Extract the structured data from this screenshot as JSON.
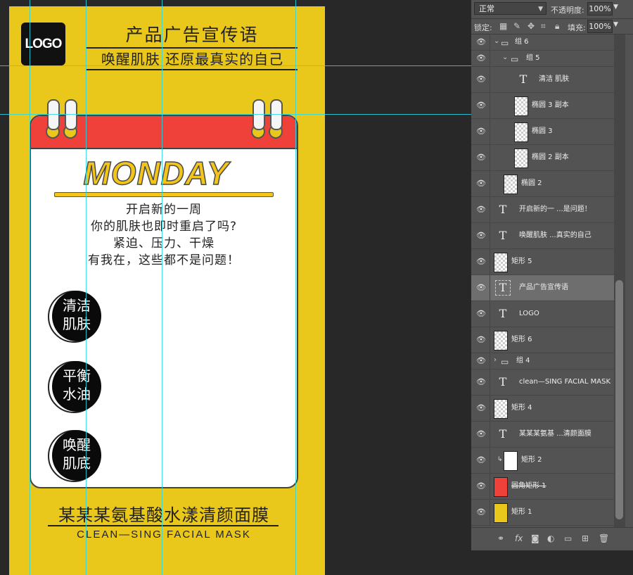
{
  "poster": {
    "logo": "LOGO",
    "headline": "产品广告宣传语",
    "subline": "唤醒肌肤 还原最真实的自己",
    "day": "MONDAY",
    "body_lines": [
      "开启新的一周",
      "你的肌肤也即时重启了吗?",
      "紧迫、压力、干燥",
      "有我在，这些都不是问题！"
    ],
    "badges": [
      {
        "line1": "清洁",
        "line2": "肌肤"
      },
      {
        "line1": "平衡",
        "line2": "水油"
      },
      {
        "line1": "唤醒",
        "line2": "肌底"
      }
    ],
    "product_cn": "某某某氨基酸水漾清颜面膜",
    "product_en": "CLEAN—SING FACIAL MASK"
  },
  "panel": {
    "blend_mode": "正常",
    "opacity_label": "不透明度:",
    "opacity_value": "100%",
    "lock_label": "锁定:",
    "fill_label": "填充:",
    "fill_value": "100%",
    "layers": [
      {
        "name": "组 6",
        "kind": "group"
      },
      {
        "name": "组 5",
        "kind": "group"
      },
      {
        "name": "清洁 肌肤",
        "kind": "text"
      },
      {
        "name": "椭圆 3 副本",
        "kind": "shape"
      },
      {
        "name": "椭圆 3",
        "kind": "shape"
      },
      {
        "name": "椭圆 2 副本",
        "kind": "shape"
      },
      {
        "name": "椭圆 2",
        "kind": "shape"
      },
      {
        "name": "开启新的一 ...是问题！",
        "kind": "text"
      },
      {
        "name": "唤醒肌肤 ...真实的自己",
        "kind": "text"
      },
      {
        "name": "矩形 5",
        "kind": "shape"
      },
      {
        "name": "产品广告宣传语",
        "kind": "text",
        "selected": true
      },
      {
        "name": "LOGO",
        "kind": "text"
      },
      {
        "name": "矩形 6",
        "kind": "shape"
      },
      {
        "name": "组 4",
        "kind": "group"
      },
      {
        "name": "clean—SING FACIAL MASK",
        "kind": "text"
      },
      {
        "name": "矩形 4",
        "kind": "shape"
      },
      {
        "name": "某某某氨基 ...清颜面膜",
        "kind": "text"
      },
      {
        "name": "矩形 2",
        "kind": "shape"
      },
      {
        "name": "圆角矩形 1",
        "kind": "shape"
      },
      {
        "name": "矩形 1",
        "kind": "shape"
      }
    ],
    "footer_fx": "fx"
  },
  "colors": {
    "poster_bg": "#eac71b",
    "calendar_header": "#f0403a",
    "guide": "#26d8e6",
    "panel_bg": "#535353"
  }
}
